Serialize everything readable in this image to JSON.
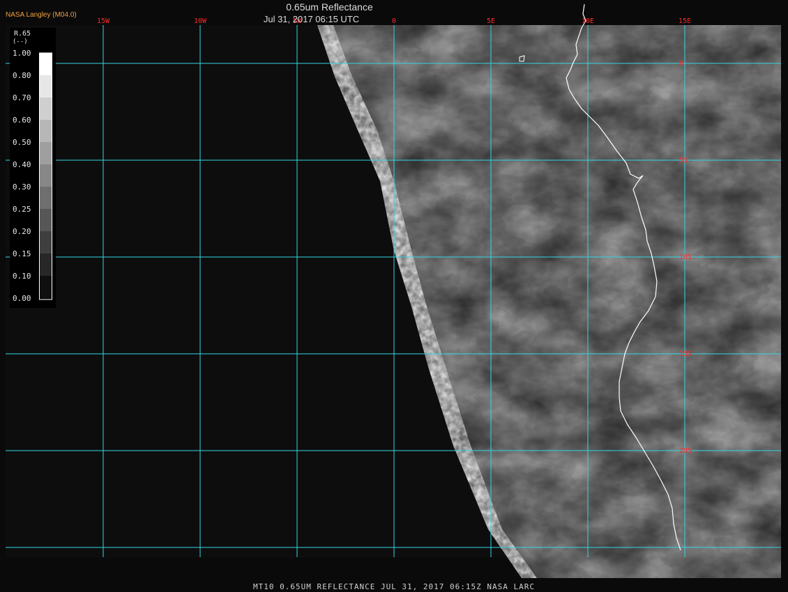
{
  "header": {
    "title": "0.65um Reflectance",
    "datetime": "Jul 31, 2017 06:15 UTC",
    "credit": "NASA Langley (M04.0)"
  },
  "footer": {
    "caption": "MT10  0.65UM REFLECTANCE   JUL 31, 2017 06:15Z   NASA LARC"
  },
  "legend": {
    "title": "R.65",
    "units": "(--)",
    "labels": [
      "1.00",
      "0.80",
      "0.70",
      "0.60",
      "0.50",
      "0.40",
      "0.30",
      "0.25",
      "0.20",
      "0.15",
      "0.10",
      "0.00"
    ]
  },
  "grid": {
    "longitude_labels": [
      "15W",
      "10W",
      "5W",
      "0",
      "5E",
      "10E",
      "15E"
    ],
    "latitude_labels": [
      "0",
      "5S",
      "10S",
      "15S",
      "20S"
    ]
  },
  "colors": {
    "grid_line": "#33d6e6",
    "grid_label": "#ff2b2b",
    "coastline": "#ffffff",
    "background": "#0a0a0a"
  }
}
